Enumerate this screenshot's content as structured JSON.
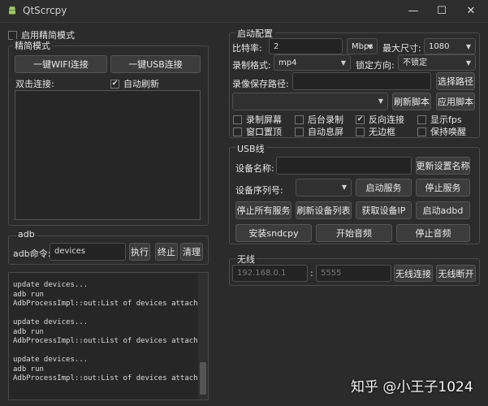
{
  "window": {
    "title": "QtScrcpy",
    "min_icon": "minimize-icon",
    "max_icon": "maximize-icon",
    "close_icon": "close-icon"
  },
  "simple_mode_toggle": {
    "label": "启用精简模式",
    "checked": false
  },
  "simple_group": {
    "title": "精简模式",
    "wifi_button": "一键WIFI连接",
    "usb_button": "一键USB连接",
    "double_click_label": "双击连接:",
    "auto_refresh": {
      "label": "自动刷新",
      "checked": true
    }
  },
  "adb_group": {
    "title": "adb",
    "cmd_label": "adb命令:",
    "cmd_value": "devices",
    "execute": "执行",
    "stop": "终止",
    "clear": "清理"
  },
  "log_lines": [
    "update devices...",
    "adb run",
    "AdbProcessImpl::out:List of devices attached",
    "",
    "update devices...",
    "adb run",
    "AdbProcessImpl::out:List of devices attached",
    "",
    "update devices...",
    "adb run",
    "AdbProcessImpl::out:List of devices attached"
  ],
  "start_config": {
    "title": "启动配置",
    "bitrate_label": "比特率:",
    "bitrate_value": "2",
    "bitrate_unit": "Mbps",
    "max_size_label": "最大尺寸:",
    "max_size_value": "1080",
    "record_format_label": "录制格式:",
    "record_format_value": "mp4",
    "lock_orientation_label": "锁定方向:",
    "lock_orientation_value": "不锁定",
    "record_path_label": "录像保存路径:",
    "record_path_value": "",
    "select_path": "选择路径",
    "script_combo_value": "",
    "refresh_script": "刷新脚本",
    "apply_script": "应用脚本",
    "options": [
      {
        "label": "录制屏幕",
        "checked": false
      },
      {
        "label": "后台录制",
        "checked": false
      },
      {
        "label": "反向连接",
        "checked": true
      },
      {
        "label": "显示fps",
        "checked": false
      },
      {
        "label": "窗口置顶",
        "checked": false
      },
      {
        "label": "自动息屏",
        "checked": false
      },
      {
        "label": "无边框",
        "checked": false
      },
      {
        "label": "保持唤醒",
        "checked": false
      }
    ]
  },
  "usb_group": {
    "title": "USB线",
    "device_name_label": "设备名称:",
    "device_name_value": "",
    "update_name": "更新设置名称",
    "serial_label": "设备序列号:",
    "serial_value": "",
    "start_service": "启动服务",
    "stop_service": "停止服务",
    "stop_all": "停止所有服务",
    "refresh_devices": "刷新设备列表",
    "get_ip": "获取设备IP",
    "start_adbd": "启动adbd",
    "install_sndcpy": "安装sndcpy",
    "start_audio": "开始音频",
    "stop_audio": "停止音频"
  },
  "wireless_group": {
    "title": "无线",
    "ip_placeholder": "192.168.0.1",
    "colon": ":",
    "port_placeholder": "5555",
    "connect": "无线连接",
    "disconnect": "无线断开"
  },
  "watermark": "知乎 @小王子1024"
}
